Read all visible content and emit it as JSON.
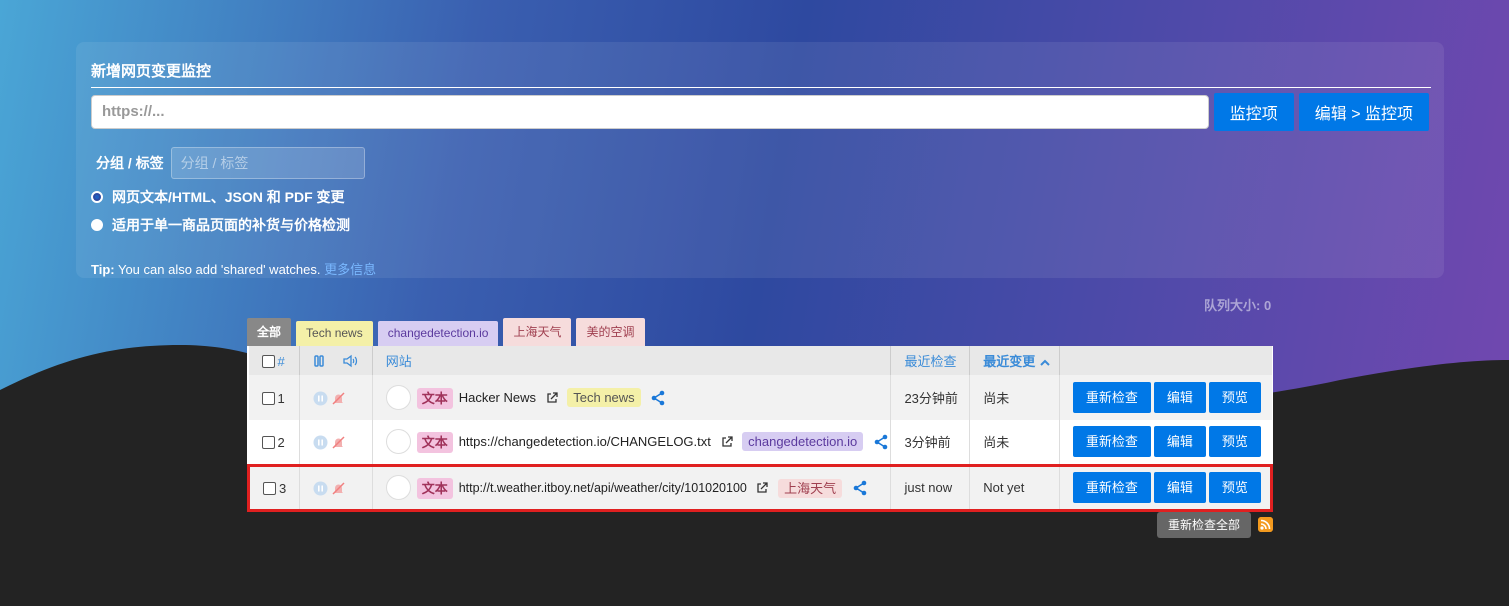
{
  "panel": {
    "title": "新增网页变更监控",
    "url_placeholder": "https://...",
    "watch_button": "监控项",
    "edit_watch_button": "编辑 > 监控项",
    "group_label": "分组 / 标签",
    "group_placeholder": "分组 / 标签",
    "radio_options": [
      {
        "label": "网页文本/HTML、JSON 和 PDF 变更",
        "checked": true
      },
      {
        "label": "适用于单一商品页面的补货与价格检测",
        "checked": false
      }
    ],
    "tip_prefix": "Tip:",
    "tip_text": " You can also add 'shared' watches. ",
    "tip_link": "更多信息"
  },
  "queue_size": "队列大小: 0",
  "tabs": [
    {
      "label": "全部",
      "style": "all"
    },
    {
      "label": "Tech news",
      "style": "tech"
    },
    {
      "label": "changedetection.io",
      "style": "cd"
    },
    {
      "label": "上海天气",
      "style": "sh"
    },
    {
      "label": "美的空调",
      "style": "md"
    }
  ],
  "table": {
    "headers": {
      "num": "#",
      "site": "网站",
      "last_checked": "最近检查",
      "last_changed": "最近变更"
    },
    "rows": [
      {
        "num": "1",
        "type_badge": "文本",
        "site": "Hacker News",
        "tag": "Tech news",
        "tag_style": "tech",
        "last_checked": "23分钟前",
        "last_changed": "尚未"
      },
      {
        "num": "2",
        "type_badge": "文本",
        "site": "https://changedetection.io/CHANGELOG.txt",
        "tag": "changedetection.io",
        "tag_style": "cd",
        "last_checked": "3分钟前",
        "last_changed": "尚未"
      },
      {
        "num": "3",
        "type_badge": "文本",
        "site": "http://t.weather.itboy.net/api/weather/city/101020100",
        "tag": "上海天气",
        "tag_style": "sh",
        "last_checked": "just now",
        "last_changed": "Not yet"
      }
    ],
    "actions": {
      "recheck": "重新检查",
      "edit": "编辑",
      "preview": "预览"
    }
  },
  "recheck_all": "重新检查全部",
  "colors": {
    "accent": "#0078e7",
    "highlight_border": "#e02020",
    "rss": "#f39a1e"
  }
}
